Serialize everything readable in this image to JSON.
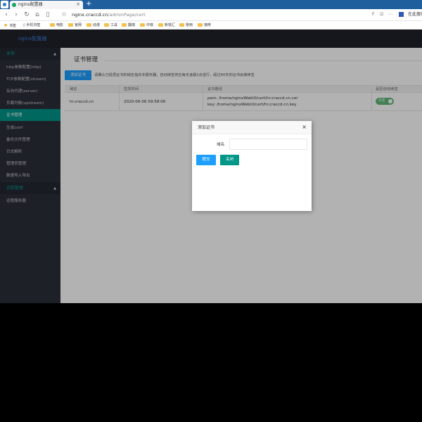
{
  "browser": {
    "tab_title": "nginx配置器",
    "tab_close": "×",
    "new_tab": "+",
    "url_host": "nginx.craccd.cn",
    "url_path": "/adminPage/cert",
    "right_f": "F",
    "right_share": "☑",
    "right_menu": "⋯",
    "search_label": "在此搜索"
  },
  "bookmarks": [
    {
      "label": "书签",
      "icon": "star-icon"
    },
    {
      "label": "手机书签",
      "icon": "phone-icon"
    },
    {
      "label": "电影",
      "icon": "folder-icon"
    },
    {
      "label": "官网",
      "icon": "folder-icon"
    },
    {
      "label": "动漫",
      "icon": "folder-icon"
    },
    {
      "label": "工具",
      "icon": "folder-icon"
    },
    {
      "label": "翻墙",
      "icon": "folder-icon"
    },
    {
      "label": "中铁",
      "icon": "folder-icon"
    },
    {
      "label": "新铁汇",
      "icon": "folder-icon"
    },
    {
      "label": "常用",
      "icon": "folder-icon"
    },
    {
      "label": "咖啡",
      "icon": "folder-icon"
    }
  ],
  "app": {
    "brand": "nginx配置器"
  },
  "sidebar": {
    "groups": [
      {
        "label": "本地",
        "arrow": "▲"
      },
      {
        "label": "远程管理",
        "arrow": "▲"
      }
    ],
    "items": [
      {
        "label": "http参数配置(http)"
      },
      {
        "label": "TCP参数配置(stream)"
      },
      {
        "label": "反向代理(server)"
      },
      {
        "label": "负载均衡(upstream)"
      },
      {
        "label": "证书管理"
      },
      {
        "label": "生成conf"
      },
      {
        "label": "备份文件管理"
      },
      {
        "label": "日志解析"
      },
      {
        "label": "管理员管理"
      },
      {
        "label": "数据导入导出"
      },
      {
        "label": "远程服务器"
      }
    ]
  },
  "page": {
    "title": "证书管理",
    "add_button": "添加证书",
    "hint": "请确认已经把证书的域名指向本服务器，自动续签将在每天凌晨2点进行，超过60天的证书会被续签"
  },
  "table": {
    "headers": [
      "域名",
      "签发时间",
      "证书路径",
      "是否自动续签"
    ],
    "rows": [
      {
        "domain": "hr.craccd.cn",
        "issued": "2020-06-06 09:58:06",
        "pem": "pem: /home/nginxWebUI/cert/hr.craccd.cn.cer",
        "key": "key: /home/nginxWebUI/cert/hr.craccd.cn.key",
        "auto_renew_label": "开启",
        "auto_renew_on": true
      }
    ]
  },
  "modal": {
    "title": "添加证书",
    "close": "×",
    "field_label": "域名",
    "field_value": "",
    "field_placeholder": "",
    "submit": "提交",
    "cancel": "关闭"
  },
  "colors": {
    "accent": "#009688",
    "primary_button": "#1e9fff",
    "toggle_on": "#5fb878",
    "sidebar_bg": "#2b2f3a",
    "header_bg": "#20222a",
    "tabstrip_bg": "#1f5f9e"
  }
}
